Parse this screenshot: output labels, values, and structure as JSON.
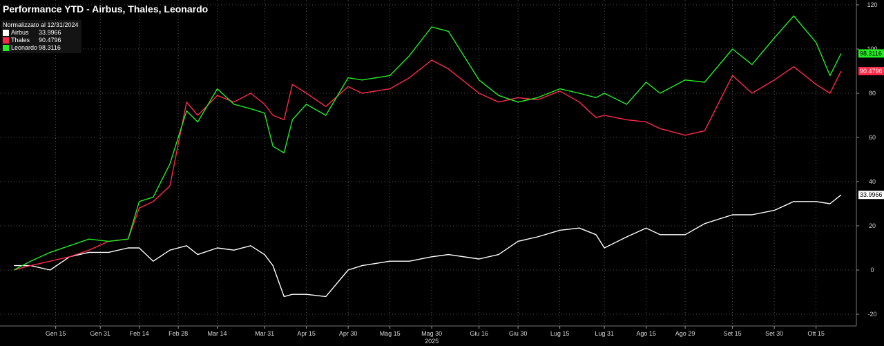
{
  "chart_data": {
    "type": "line",
    "title": "Performance YTD - Airbus, Thales, Leonardo",
    "normalization_note": "Normalizzato al 12/31/2024",
    "x_ticks": [
      "Gen 15",
      "Gen 31",
      "Feb 14",
      "Feb 28",
      "Mar 14",
      "Mar 31",
      "Apr 15",
      "Apr 30",
      "Mag 15",
      "Mag 30",
      "Giu 16",
      "Giu 30",
      "Lug 15",
      "Lug 31",
      "Ago 15",
      "Ago 29",
      "Set 15",
      "Set 30",
      "Ott 15"
    ],
    "x_year_label": "2025",
    "y_ticks": [
      -20,
      0,
      20,
      40,
      60,
      80,
      100,
      120
    ],
    "ylim": [
      -25,
      123
    ],
    "y_axis_side": "right",
    "grid": true,
    "legend_position": "top-left",
    "series": [
      {
        "name": "Airbus",
        "last_value": "33.9966",
        "color": "#ffffff",
        "points": [
          [
            "2024-12-31",
            2
          ],
          [
            "2025-01-06",
            2
          ],
          [
            "2025-01-13",
            0
          ],
          [
            "2025-01-20",
            6
          ],
          [
            "2025-01-27",
            8
          ],
          [
            "2025-02-03",
            8
          ],
          [
            "2025-02-10",
            10
          ],
          [
            "2025-02-14",
            10
          ],
          [
            "2025-02-19",
            4
          ],
          [
            "2025-02-25",
            9
          ],
          [
            "2025-03-03",
            11
          ],
          [
            "2025-03-07",
            7
          ],
          [
            "2025-03-14",
            10
          ],
          [
            "2025-03-20",
            9
          ],
          [
            "2025-03-26",
            11
          ],
          [
            "2025-03-31",
            7
          ],
          [
            "2025-04-03",
            2
          ],
          [
            "2025-04-07",
            -12
          ],
          [
            "2025-04-10",
            -11
          ],
          [
            "2025-04-15",
            -11
          ],
          [
            "2025-04-22",
            -12
          ],
          [
            "2025-04-30",
            0
          ],
          [
            "2025-05-05",
            2
          ],
          [
            "2025-05-15",
            4
          ],
          [
            "2025-05-22",
            4
          ],
          [
            "2025-05-30",
            6
          ],
          [
            "2025-06-05",
            7
          ],
          [
            "2025-06-16",
            5
          ],
          [
            "2025-06-23",
            7
          ],
          [
            "2025-06-30",
            13
          ],
          [
            "2025-07-07",
            15
          ],
          [
            "2025-07-15",
            18
          ],
          [
            "2025-07-22",
            19
          ],
          [
            "2025-07-28",
            16
          ],
          [
            "2025-07-31",
            10
          ],
          [
            "2025-08-08",
            15
          ],
          [
            "2025-08-15",
            19
          ],
          [
            "2025-08-20",
            16
          ],
          [
            "2025-08-29",
            16
          ],
          [
            "2025-09-05",
            21
          ],
          [
            "2025-09-15",
            25
          ],
          [
            "2025-09-22",
            25
          ],
          [
            "2025-09-30",
            27
          ],
          [
            "2025-10-07",
            31
          ],
          [
            "2025-10-15",
            31
          ],
          [
            "2025-10-20",
            30
          ],
          [
            "2025-10-24",
            34
          ]
        ]
      },
      {
        "name": "Thales",
        "last_value": "90.4796",
        "color": "#ff2a4a",
        "points": [
          [
            "2024-12-31",
            0
          ],
          [
            "2025-01-06",
            2
          ],
          [
            "2025-01-13",
            4
          ],
          [
            "2025-01-20",
            6
          ],
          [
            "2025-01-27",
            9
          ],
          [
            "2025-02-03",
            13
          ],
          [
            "2025-02-10",
            14
          ],
          [
            "2025-02-14",
            28
          ],
          [
            "2025-02-19",
            31
          ],
          [
            "2025-02-25",
            38
          ],
          [
            "2025-03-03",
            76
          ],
          [
            "2025-03-07",
            70
          ],
          [
            "2025-03-14",
            79
          ],
          [
            "2025-03-20",
            76
          ],
          [
            "2025-03-26",
            80
          ],
          [
            "2025-03-31",
            75
          ],
          [
            "2025-04-03",
            70
          ],
          [
            "2025-04-07",
            68
          ],
          [
            "2025-04-10",
            84
          ],
          [
            "2025-04-15",
            80
          ],
          [
            "2025-04-22",
            74
          ],
          [
            "2025-04-30",
            83
          ],
          [
            "2025-05-05",
            80
          ],
          [
            "2025-05-15",
            82
          ],
          [
            "2025-05-22",
            87
          ],
          [
            "2025-05-30",
            95
          ],
          [
            "2025-06-05",
            91
          ],
          [
            "2025-06-16",
            80
          ],
          [
            "2025-06-23",
            76
          ],
          [
            "2025-06-30",
            78
          ],
          [
            "2025-07-07",
            77
          ],
          [
            "2025-07-15",
            81
          ],
          [
            "2025-07-22",
            76
          ],
          [
            "2025-07-28",
            69
          ],
          [
            "2025-07-31",
            70
          ],
          [
            "2025-08-08",
            68
          ],
          [
            "2025-08-15",
            67
          ],
          [
            "2025-08-20",
            64
          ],
          [
            "2025-08-29",
            61
          ],
          [
            "2025-09-05",
            63
          ],
          [
            "2025-09-15",
            88
          ],
          [
            "2025-09-22",
            80
          ],
          [
            "2025-09-30",
            86
          ],
          [
            "2025-10-07",
            92
          ],
          [
            "2025-10-15",
            84
          ],
          [
            "2025-10-20",
            80
          ],
          [
            "2025-10-24",
            90
          ]
        ]
      },
      {
        "name": "Leonardo",
        "last_value": "98.3116",
        "color": "#22ee22",
        "points": [
          [
            "2024-12-31",
            0
          ],
          [
            "2025-01-06",
            4
          ],
          [
            "2025-01-13",
            8
          ],
          [
            "2025-01-20",
            11
          ],
          [
            "2025-01-27",
            14
          ],
          [
            "2025-02-03",
            13
          ],
          [
            "2025-02-10",
            14
          ],
          [
            "2025-02-14",
            31
          ],
          [
            "2025-02-19",
            33
          ],
          [
            "2025-02-25",
            48
          ],
          [
            "2025-03-03",
            72
          ],
          [
            "2025-03-07",
            67
          ],
          [
            "2025-03-14",
            82
          ],
          [
            "2025-03-20",
            75
          ],
          [
            "2025-03-26",
            73
          ],
          [
            "2025-03-31",
            71
          ],
          [
            "2025-04-03",
            56
          ],
          [
            "2025-04-07",
            53
          ],
          [
            "2025-04-10",
            68
          ],
          [
            "2025-04-15",
            75
          ],
          [
            "2025-04-22",
            70
          ],
          [
            "2025-04-30",
            87
          ],
          [
            "2025-05-05",
            86
          ],
          [
            "2025-05-15",
            88
          ],
          [
            "2025-05-22",
            97
          ],
          [
            "2025-05-30",
            110
          ],
          [
            "2025-06-05",
            108
          ],
          [
            "2025-06-16",
            86
          ],
          [
            "2025-06-23",
            79
          ],
          [
            "2025-06-30",
            76
          ],
          [
            "2025-07-07",
            78
          ],
          [
            "2025-07-15",
            82
          ],
          [
            "2025-07-22",
            80
          ],
          [
            "2025-07-28",
            78
          ],
          [
            "2025-07-31",
            80
          ],
          [
            "2025-08-08",
            75
          ],
          [
            "2025-08-15",
            85
          ],
          [
            "2025-08-20",
            80
          ],
          [
            "2025-08-29",
            86
          ],
          [
            "2025-09-05",
            85
          ],
          [
            "2025-09-15",
            100
          ],
          [
            "2025-09-22",
            93
          ],
          [
            "2025-09-30",
            105
          ],
          [
            "2025-10-07",
            115
          ],
          [
            "2025-10-15",
            103
          ],
          [
            "2025-10-20",
            88
          ],
          [
            "2025-10-24",
            98
          ]
        ]
      }
    ]
  }
}
